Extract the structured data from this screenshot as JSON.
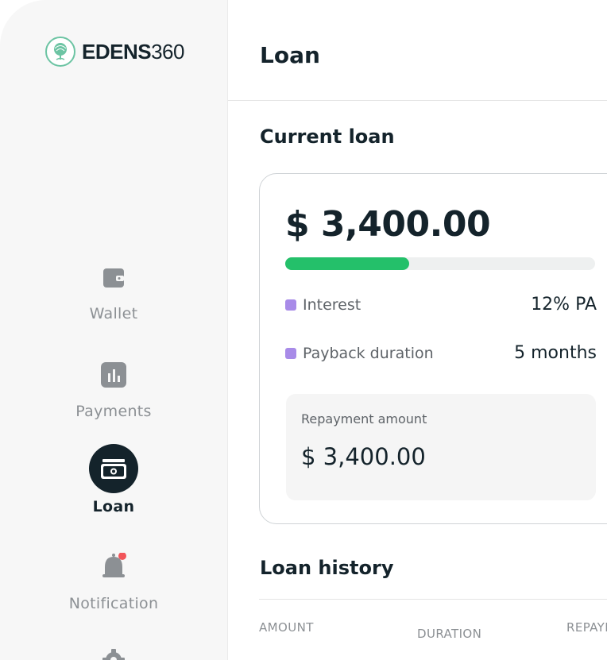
{
  "brand": {
    "name_bold": "EDENS",
    "name_light": "360",
    "accent": "#6cc4a3"
  },
  "sidebar": {
    "items": [
      {
        "label": "Wallet",
        "icon": "wallet-icon",
        "active": false
      },
      {
        "label": "Payments",
        "icon": "bar-chart-icon",
        "active": false
      },
      {
        "label": "Loan",
        "icon": "cash-icon",
        "active": true
      },
      {
        "label": "Notification",
        "icon": "bell-icon",
        "active": false,
        "has_badge": true
      },
      {
        "label": "",
        "icon": "gear-icon",
        "active": false
      }
    ]
  },
  "page": {
    "title": "Loan"
  },
  "current_loan": {
    "section_title": "Current loan",
    "amount": "$ 3,400.00",
    "progress": 0.4,
    "progress_color": "#24c06a",
    "interest_label": "Interest",
    "interest_value": "12% PA",
    "duration_label": "Payback duration",
    "duration_value": "5 months",
    "repayment_label": "Repayment amount",
    "repayment_value": "$ 3,400.00"
  },
  "loan_history": {
    "section_title": "Loan history",
    "columns": [
      "AMOUNT",
      "DURATION",
      "REPAYMENT"
    ]
  }
}
